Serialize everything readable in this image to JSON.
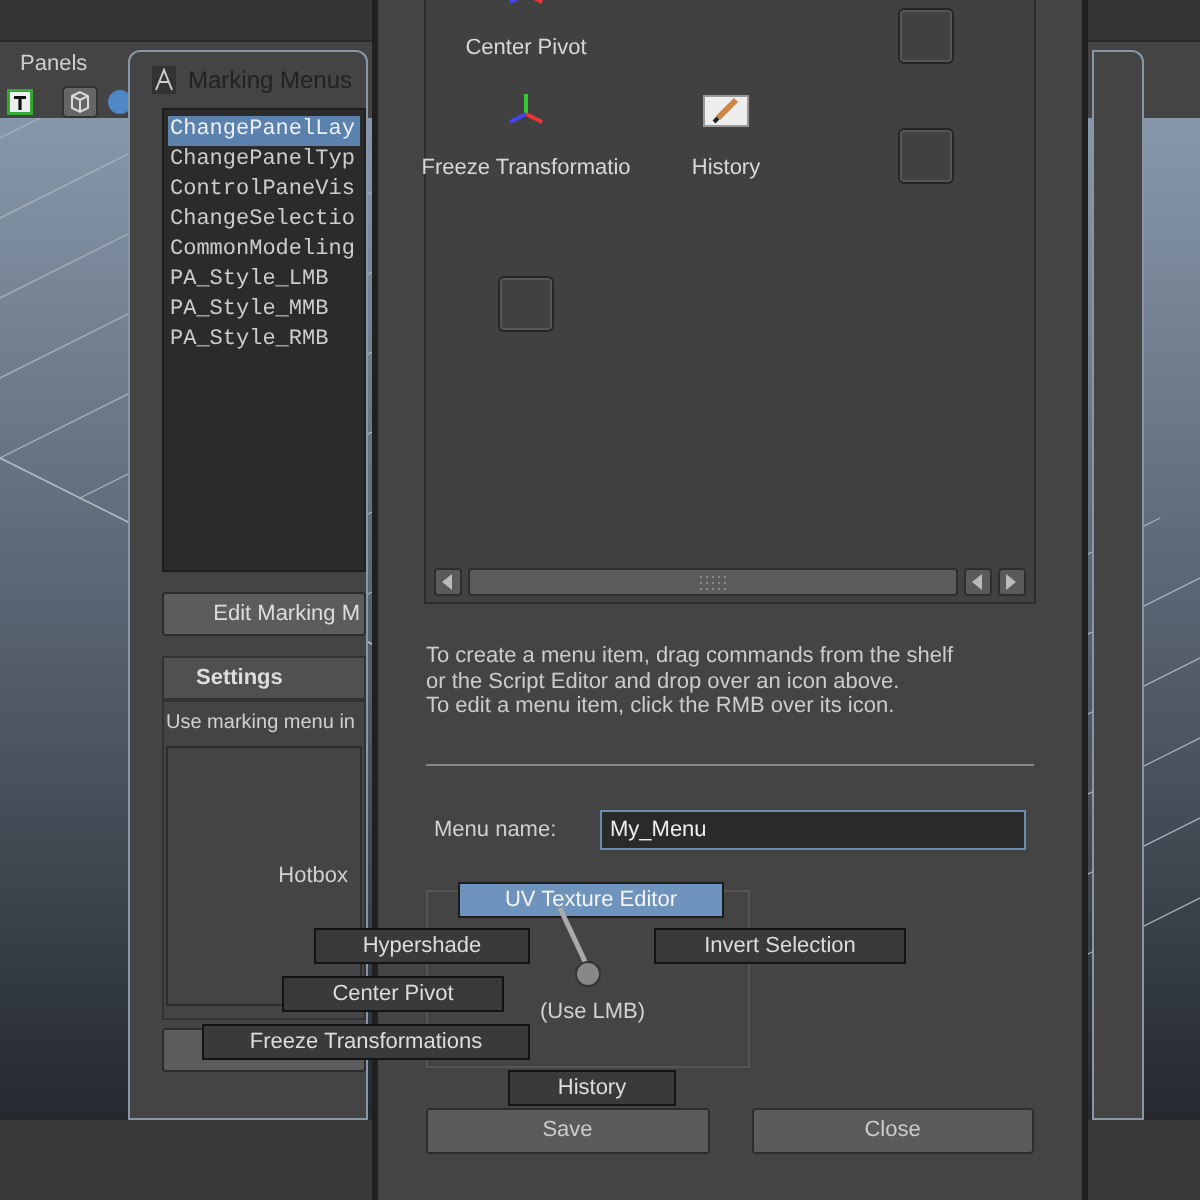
{
  "toolbar": {
    "menu": "Panels"
  },
  "marking_menus_window": {
    "title": "Marking Menus",
    "list": [
      {
        "label": "ChangePanelLay",
        "selected": true
      },
      {
        "label": "ChangePanelTyp",
        "selected": false
      },
      {
        "label": "ControlPaneVis",
        "selected": false
      },
      {
        "label": "ChangeSelectio",
        "selected": false
      },
      {
        "label": "CommonModeling",
        "selected": false
      },
      {
        "label": "PA_Style_LMB",
        "selected": false
      },
      {
        "label": "PA_Style_MMB",
        "selected": false
      },
      {
        "label": "PA_Style_RMB",
        "selected": false
      }
    ],
    "edit_button": "Edit Marking M",
    "settings": {
      "title": "Settings",
      "description": "Use marking menu in",
      "hotbox_label": "Hotbox"
    }
  },
  "editor_window": {
    "icons": [
      {
        "kind": "axis",
        "label": "Center Pivot"
      },
      {
        "kind": "blank"
      },
      {
        "kind": "slot"
      },
      {
        "kind": "axis",
        "label": "Freeze Transformatio"
      },
      {
        "kind": "pencil",
        "label": "History"
      },
      {
        "kind": "slot"
      },
      {
        "kind": "slot"
      }
    ],
    "instructions": [
      "To create a menu item, drag commands from the shelf",
      "or the Script Editor and drop over an icon above.",
      "To edit a menu item, click the RMB over its icon."
    ],
    "menu_name": {
      "label": "Menu name:",
      "value": "My_Menu"
    },
    "test_area": {
      "hint": "(Use LMB)"
    },
    "buttons": [
      "Save",
      "Close"
    ]
  },
  "marking_menu_popup": [
    {
      "label": "UV Texture Editor",
      "selected": true
    },
    {
      "label": "Hypershade",
      "selected": false
    },
    {
      "label": "Invert Selection",
      "selected": false
    },
    {
      "label": "Center Pivot",
      "selected": false
    },
    {
      "label": "Freeze Transformations",
      "selected": false
    },
    {
      "label": "History",
      "selected": false
    }
  ]
}
